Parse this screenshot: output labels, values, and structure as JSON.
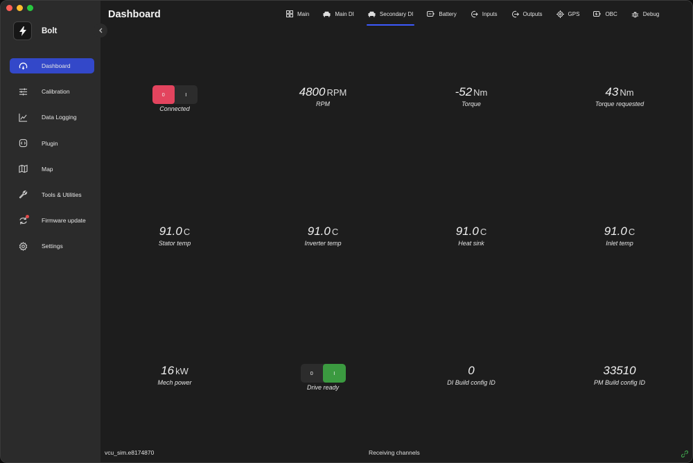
{
  "app": {
    "name": "Bolt"
  },
  "sidebar": {
    "items": [
      {
        "label": "Dashboard",
        "icon": "gauge-icon",
        "active": true
      },
      {
        "label": "Calibration",
        "icon": "sliders-icon"
      },
      {
        "label": "Data Logging",
        "icon": "chart-line-icon"
      },
      {
        "label": "Plugin",
        "icon": "plugin-icon"
      },
      {
        "label": "Map",
        "icon": "map-icon"
      },
      {
        "label": "Tools & Utilities",
        "icon": "wrench-icon"
      },
      {
        "label": "Firmware update",
        "icon": "refresh-icon",
        "badge": true
      },
      {
        "label": "Settings",
        "icon": "gear-icon"
      }
    ]
  },
  "header": {
    "title": "Dashboard"
  },
  "tabs": [
    {
      "label": "Main",
      "icon": "grid-icon"
    },
    {
      "label": "Main DI",
      "icon": "car-icon"
    },
    {
      "label": "Secondary DI",
      "icon": "car-icon",
      "active": true
    },
    {
      "label": "Battery",
      "icon": "battery-icon"
    },
    {
      "label": "Inputs",
      "icon": "input-icon"
    },
    {
      "label": "Outputs",
      "icon": "output-icon"
    },
    {
      "label": "GPS",
      "icon": "target-icon"
    },
    {
      "label": "OBC",
      "icon": "charger-icon"
    },
    {
      "label": "Debug",
      "icon": "bug-icon"
    }
  ],
  "metrics": {
    "connected": {
      "caption": "Connected",
      "off_label": "0",
      "on_label": "I",
      "state": "off"
    },
    "rpm": {
      "value": "4800",
      "unit": "RPM",
      "caption": "RPM"
    },
    "torque": {
      "value": "-52",
      "unit": "Nm",
      "caption": "Torque"
    },
    "torque_requested": {
      "value": "43",
      "unit": "Nm",
      "caption": "Torque requested"
    },
    "stator_temp": {
      "value": "91.0",
      "unit": "C",
      "caption": "Stator temp"
    },
    "inverter_temp": {
      "value": "91.0",
      "unit": "C",
      "caption": "Inverter temp"
    },
    "heat_sink": {
      "value": "91.0",
      "unit": "C",
      "caption": "Heat sink"
    },
    "inlet_temp": {
      "value": "91.0",
      "unit": "C",
      "caption": "Inlet temp"
    },
    "mech_power": {
      "value": "16",
      "unit": "kW",
      "caption": "Mech power"
    },
    "drive_ready": {
      "caption": "Drive ready",
      "off_label": "0",
      "on_label": "I",
      "state": "on"
    },
    "di_build_config_id": {
      "value": "0",
      "caption": "DI Build config ID"
    },
    "pm_build_config_id": {
      "value": "33510",
      "caption": "PM Build config ID"
    }
  },
  "status": {
    "device": "vcu_sim.e8174870",
    "message": "Receiving channels",
    "link_icon": "link-icon"
  },
  "colors": {
    "accent": "#3348c9",
    "tab_underline": "#3d5afe",
    "toggle_off_active": "#e3445e",
    "toggle_on_active": "#3b9a40",
    "status_link": "#3fa34d"
  }
}
